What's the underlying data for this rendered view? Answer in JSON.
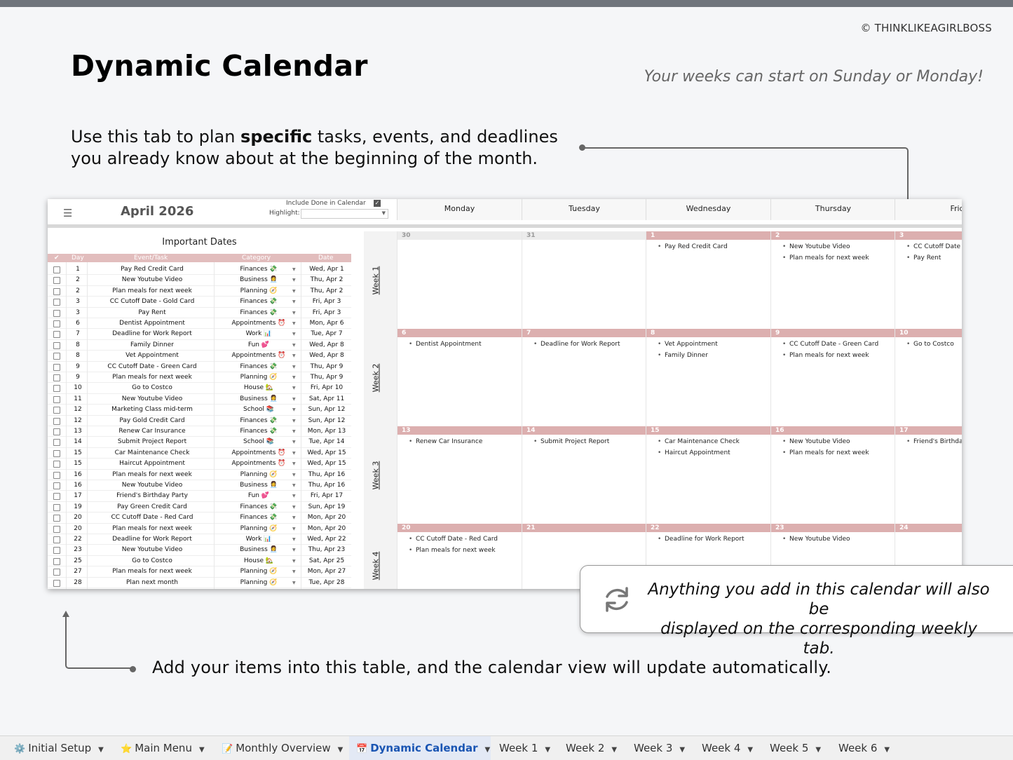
{
  "copyright": "© THINKLIKEAGIRLBOSS",
  "title": "Dynamic Calendar",
  "subtitle": "Your weeks can start on Sunday or Monday!",
  "intro": {
    "pre": "Use this tab to plan ",
    "bold": "specific",
    "post": " tasks, events, and deadlines",
    "line2": "you already know about at the beginning of the month."
  },
  "bottom_caption": "Add your items into this table, and the calendar view will update automatically.",
  "note": {
    "line1": "Anything you add in this calendar will also be",
    "line2": "displayed on the corresponding weekly tab."
  },
  "sheet": {
    "month": "April 2026",
    "include_done_label": "Include Done in Calendar",
    "highlight_label": "Highlight:",
    "day_headers": [
      "Monday",
      "Tuesday",
      "Wednesday",
      "Thursday",
      "Frid"
    ],
    "table_title": "Important Dates",
    "columns": [
      "✔",
      "Day",
      "Event/Task",
      "Category",
      "Date"
    ],
    "rows": [
      {
        "day": "1",
        "task": "Pay Red Credit Card",
        "cat": "Finances 💸",
        "date": "Wed, Apr 1"
      },
      {
        "day": "2",
        "task": "New Youtube Video",
        "cat": "Business 👩‍💼",
        "date": "Thu, Apr 2"
      },
      {
        "day": "2",
        "task": "Plan meals for next week",
        "cat": "Planning 🧭",
        "date": "Thu, Apr 2"
      },
      {
        "day": "3",
        "task": "CC Cutoff Date - Gold Card",
        "cat": "Finances 💸",
        "date": "Fri, Apr 3"
      },
      {
        "day": "3",
        "task": "Pay Rent",
        "cat": "Finances 💸",
        "date": "Fri, Apr 3"
      },
      {
        "day": "6",
        "task": "Dentist Appointment",
        "cat": "Appointments ⏰",
        "date": "Mon, Apr 6"
      },
      {
        "day": "7",
        "task": "Deadline for Work Report",
        "cat": "Work 📊",
        "date": "Tue, Apr 7"
      },
      {
        "day": "8",
        "task": "Family Dinner",
        "cat": "Fun 💕",
        "date": "Wed, Apr 8"
      },
      {
        "day": "8",
        "task": "Vet Appointment",
        "cat": "Appointments ⏰",
        "date": "Wed, Apr 8"
      },
      {
        "day": "9",
        "task": "CC Cutoff Date - Green Card",
        "cat": "Finances 💸",
        "date": "Thu, Apr 9"
      },
      {
        "day": "9",
        "task": "Plan meals for next week",
        "cat": "Planning 🧭",
        "date": "Thu, Apr 9"
      },
      {
        "day": "10",
        "task": "Go to Costco",
        "cat": "House 🏡",
        "date": "Fri, Apr 10"
      },
      {
        "day": "11",
        "task": "New Youtube Video",
        "cat": "Business 👩‍💼",
        "date": "Sat, Apr 11"
      },
      {
        "day": "12",
        "task": "Marketing Class mid-term",
        "cat": "School 📚",
        "date": "Sun, Apr 12"
      },
      {
        "day": "12",
        "task": "Pay Gold Credit Card",
        "cat": "Finances 💸",
        "date": "Sun, Apr 12"
      },
      {
        "day": "13",
        "task": "Renew Car Insurance",
        "cat": "Finances 💸",
        "date": "Mon, Apr 13"
      },
      {
        "day": "14",
        "task": "Submit Project Report",
        "cat": "School 📚",
        "date": "Tue, Apr 14"
      },
      {
        "day": "15",
        "task": "Car Maintenance Check",
        "cat": "Appointments ⏰",
        "date": "Wed, Apr 15"
      },
      {
        "day": "15",
        "task": "Haircut Appointment",
        "cat": "Appointments ⏰",
        "date": "Wed, Apr 15"
      },
      {
        "day": "16",
        "task": "Plan meals for next week",
        "cat": "Planning 🧭",
        "date": "Thu, Apr 16"
      },
      {
        "day": "16",
        "task": "New Youtube Video",
        "cat": "Business 👩‍💼",
        "date": "Thu, Apr 16"
      },
      {
        "day": "17",
        "task": "Friend's Birthday Party",
        "cat": "Fun 💕",
        "date": "Fri, Apr 17"
      },
      {
        "day": "19",
        "task": "Pay Green Credit Card",
        "cat": "Finances 💸",
        "date": "Sun, Apr 19"
      },
      {
        "day": "20",
        "task": "CC Cutoff Date - Red Card",
        "cat": "Finances 💸",
        "date": "Mon, Apr 20"
      },
      {
        "day": "20",
        "task": "Plan meals for next week",
        "cat": "Planning 🧭",
        "date": "Mon, Apr 20"
      },
      {
        "day": "22",
        "task": "Deadline for Work Report",
        "cat": "Work 📊",
        "date": "Wed, Apr 22"
      },
      {
        "day": "23",
        "task": "New Youtube Video",
        "cat": "Business 👩‍💼",
        "date": "Thu, Apr 23"
      },
      {
        "day": "25",
        "task": "Go to Costco",
        "cat": "House 🏡",
        "date": "Sat, Apr 25"
      },
      {
        "day": "27",
        "task": "Plan meals for next week",
        "cat": "Planning 🧭",
        "date": "Mon, Apr 27"
      },
      {
        "day": "28",
        "task": "Plan next month",
        "cat": "Planning 🧭",
        "date": "Tue, Apr 28"
      }
    ],
    "weeks": [
      {
        "label": "Week 1",
        "days": [
          {
            "num": "30",
            "current": false,
            "events": []
          },
          {
            "num": "31",
            "current": false,
            "events": []
          },
          {
            "num": "1",
            "current": true,
            "events": [
              "Pay Red Credit Card"
            ]
          },
          {
            "num": "2",
            "current": true,
            "events": [
              "New Youtube Video",
              "Plan meals for next week"
            ]
          },
          {
            "num": "3",
            "current": true,
            "events": [
              "CC Cutoff Date",
              "Pay Rent"
            ]
          }
        ]
      },
      {
        "label": "Week 2",
        "days": [
          {
            "num": "6",
            "current": true,
            "events": [
              "Dentist Appointment"
            ]
          },
          {
            "num": "7",
            "current": true,
            "events": [
              "Deadline for Work Report"
            ]
          },
          {
            "num": "8",
            "current": true,
            "events": [
              "Vet Appointment",
              "Family Dinner"
            ]
          },
          {
            "num": "9",
            "current": true,
            "events": [
              "CC Cutoff Date - Green Card",
              "Plan meals for next week"
            ]
          },
          {
            "num": "10",
            "current": true,
            "events": [
              "Go to Costco"
            ]
          }
        ]
      },
      {
        "label": "Week 3",
        "days": [
          {
            "num": "13",
            "current": true,
            "events": [
              "Renew Car Insurance"
            ]
          },
          {
            "num": "14",
            "current": true,
            "events": [
              "Submit Project Report"
            ]
          },
          {
            "num": "15",
            "current": true,
            "events": [
              "Car Maintenance Check",
              "Haircut Appointment"
            ]
          },
          {
            "num": "16",
            "current": true,
            "events": [
              "New Youtube Video",
              "Plan meals for next week"
            ]
          },
          {
            "num": "17",
            "current": true,
            "events": [
              "Friend's Birthday"
            ]
          }
        ]
      },
      {
        "label": "Week 4",
        "days": [
          {
            "num": "20",
            "current": true,
            "events": [
              "CC Cutoff Date - Red Card",
              "Plan meals for next week"
            ]
          },
          {
            "num": "21",
            "current": true,
            "events": []
          },
          {
            "num": "22",
            "current": true,
            "events": [
              "Deadline for Work Report"
            ]
          },
          {
            "num": "23",
            "current": true,
            "events": [
              "New Youtube Video"
            ]
          },
          {
            "num": "24",
            "current": true,
            "events": []
          }
        ]
      }
    ]
  },
  "tabs": [
    {
      "icon": "⚙️",
      "label": "Initial Setup",
      "active": false
    },
    {
      "icon": "⭐",
      "label": "Main Menu",
      "active": false
    },
    {
      "icon": "📝",
      "label": "Monthly Overview",
      "active": false
    },
    {
      "icon": "📅",
      "label": "Dynamic Calendar",
      "active": true
    },
    {
      "icon": "",
      "label": "Week 1",
      "active": false
    },
    {
      "icon": "",
      "label": "Week 2",
      "active": false
    },
    {
      "icon": "",
      "label": "Week 3",
      "active": false
    },
    {
      "icon": "",
      "label": "Week 4",
      "active": false
    },
    {
      "icon": "",
      "label": "Week 5",
      "active": false
    },
    {
      "icon": "",
      "label": "Week 6",
      "active": false
    }
  ]
}
